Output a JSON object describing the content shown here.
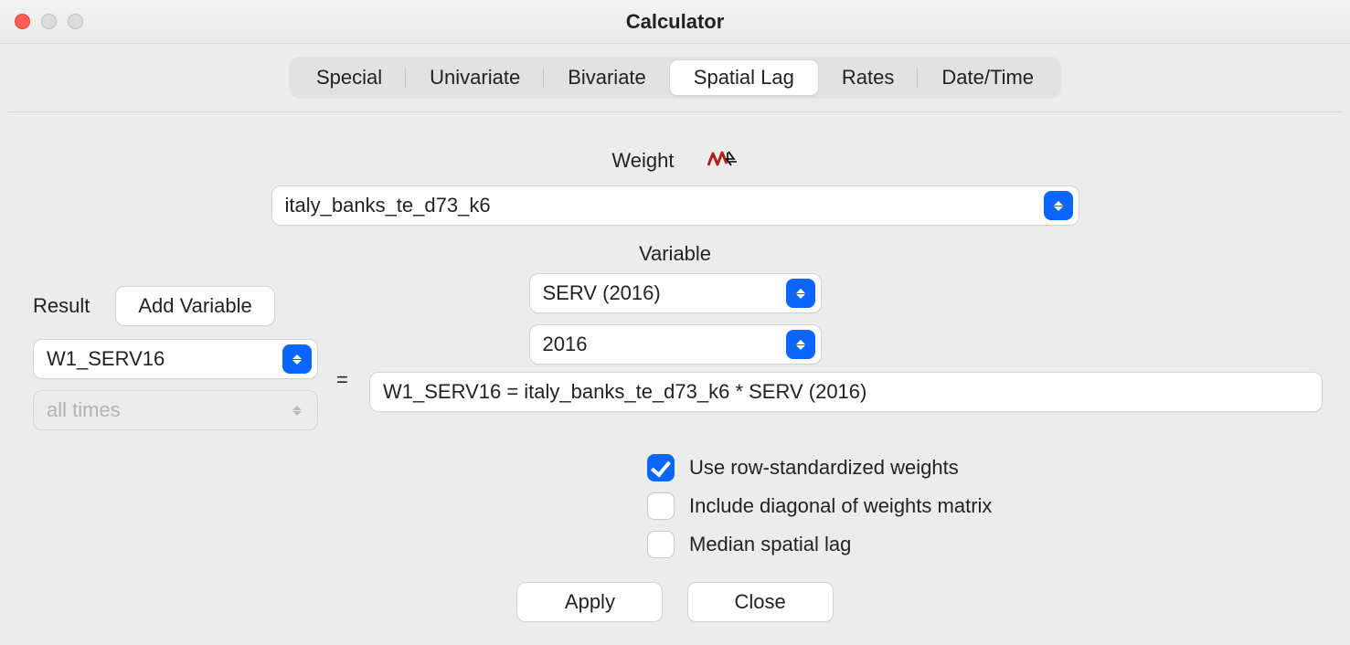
{
  "window": {
    "title": "Calculator"
  },
  "tabs": {
    "items": [
      "Special",
      "Univariate",
      "Bivariate",
      "Spatial Lag",
      "Rates",
      "Date/Time"
    ],
    "active": 3
  },
  "weight": {
    "label": "Weight",
    "value": "italy_banks_te_d73_k6"
  },
  "variable": {
    "label": "Variable",
    "value": "SERV (2016)",
    "year": "2016"
  },
  "result": {
    "label": "Result",
    "add_button": "Add Variable",
    "value": "W1_SERV16",
    "time_value": "all times",
    "eq_sign": "="
  },
  "formula": "W1_SERV16 = italy_banks_te_d73_k6 * SERV (2016)",
  "checks": {
    "rowstd": {
      "label": "Use row-standardized weights",
      "checked": true
    },
    "diag": {
      "label": "Include diagonal of weights matrix",
      "checked": false
    },
    "median": {
      "label": "Median spatial lag",
      "checked": false
    }
  },
  "buttons": {
    "apply": "Apply",
    "close": "Close"
  }
}
